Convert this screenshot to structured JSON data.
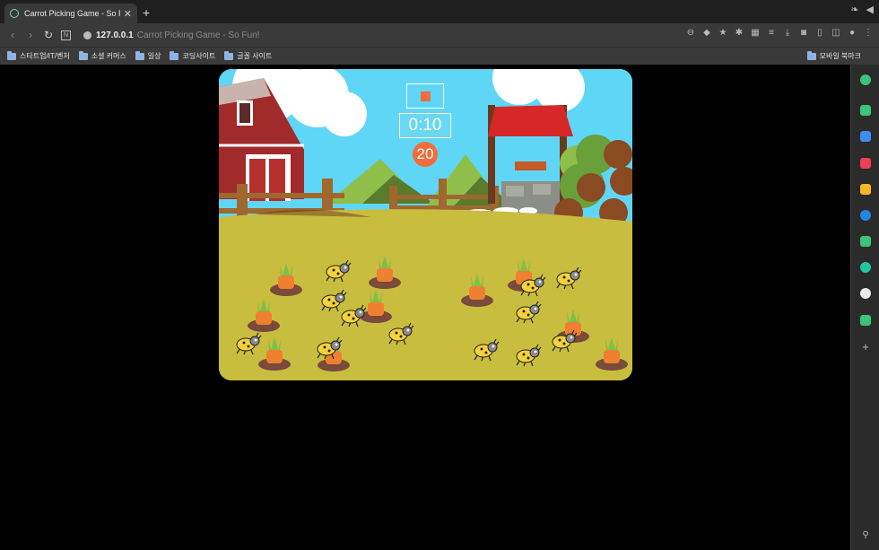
{
  "browser": {
    "tab_title": "Carrot Picking Game - So Fun!",
    "tab_close": "✕",
    "new_tab": "+",
    "url_host": "127.0.0.1",
    "url_title": "Carrot Picking Game - So Fun!",
    "n_icon_label": "N"
  },
  "bookmarks": {
    "items": [
      {
        "label": "스타트업/IT/벤처"
      },
      {
        "label": "소셜 커머스"
      },
      {
        "label": "일상"
      },
      {
        "label": "코딩사이트"
      },
      {
        "label": "글꼴 사이트"
      }
    ],
    "mobile": "모바일 북마크"
  },
  "game": {
    "timer": "0:10",
    "score": "20",
    "carrots": 10,
    "bugs": 10,
    "colors": {
      "sky": "#5fd6f5",
      "ground": "#c8bd3f",
      "accent": "#f26b3a",
      "carrot": "#ee8030",
      "leaf": "#7fbf4a"
    }
  }
}
